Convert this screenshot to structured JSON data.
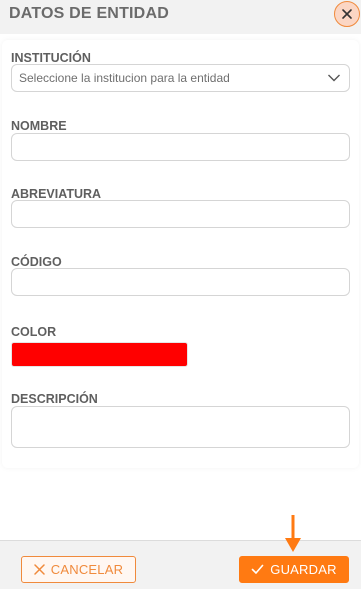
{
  "header": {
    "title": "DATOS DE ENTIDAD",
    "close_icon": "close-icon"
  },
  "form": {
    "institucion": {
      "label": "INSTITUCIÓN",
      "placeholder": "Seleccione la institucion para la entidad"
    },
    "nombre": {
      "label": "NOMBRE",
      "value": ""
    },
    "abreviatura": {
      "label": "ABREVIATURA",
      "value": ""
    },
    "codigo": {
      "label": "CÓDIGO",
      "value": ""
    },
    "color": {
      "label": "COLOR",
      "value": "#ff0000"
    },
    "descripcion": {
      "label": "DESCRIPCIÓN",
      "value": ""
    }
  },
  "footer": {
    "cancel_label": "CANCELAR",
    "save_label": "GUARDAR"
  },
  "colors": {
    "accent": "#ff7a12",
    "accent_outline": "#f08a3c"
  }
}
